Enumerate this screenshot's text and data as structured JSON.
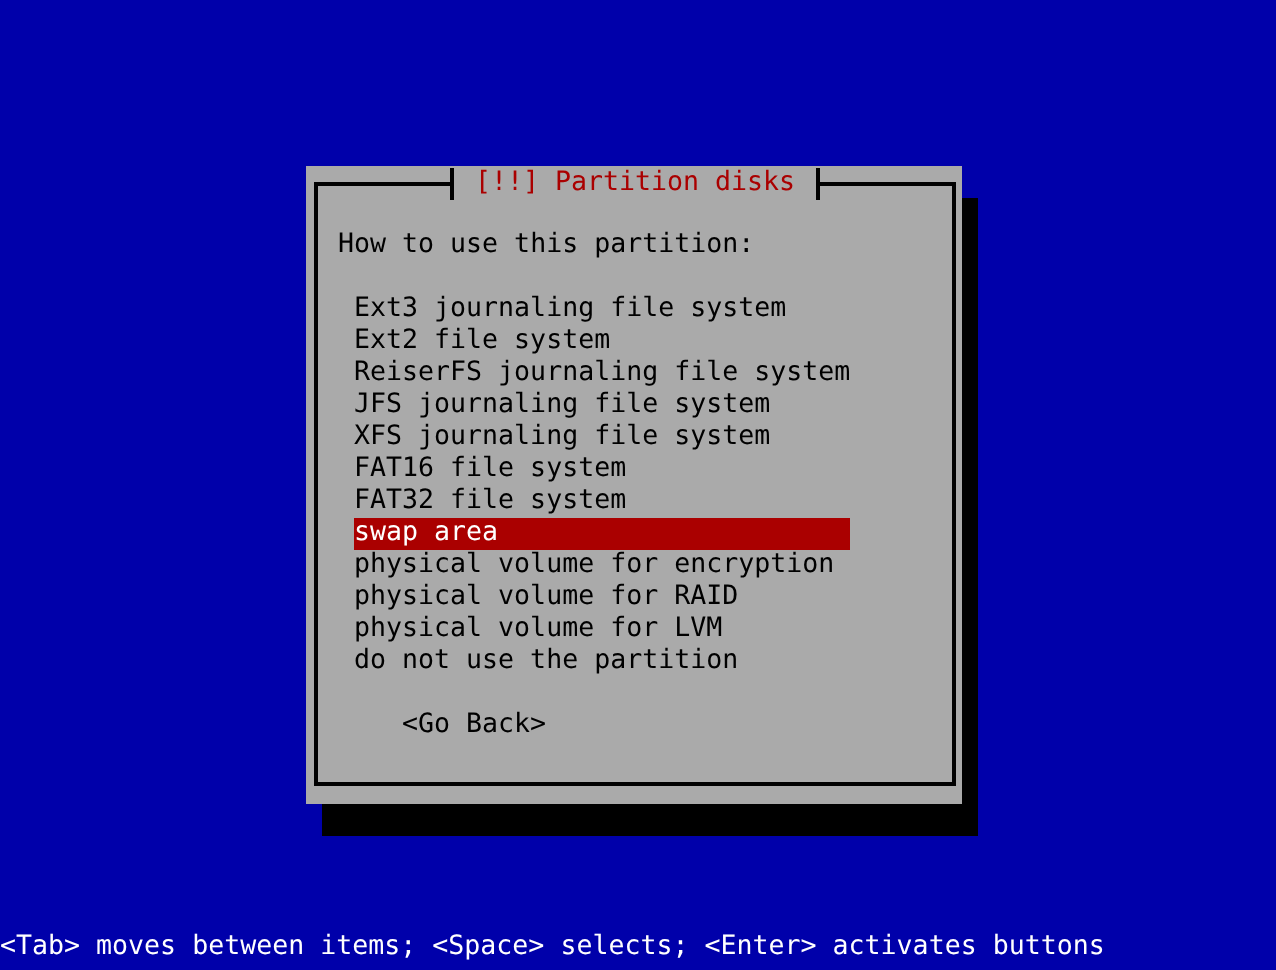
{
  "dialog": {
    "title": "[!!] Partition disks",
    "prompt": "How to use this partition:",
    "options": [
      {
        "label": "Ext3 journaling file system",
        "selected": false
      },
      {
        "label": "Ext2 file system",
        "selected": false
      },
      {
        "label": "ReiserFS journaling file system",
        "selected": false
      },
      {
        "label": "JFS journaling file system",
        "selected": false
      },
      {
        "label": "XFS journaling file system",
        "selected": false
      },
      {
        "label": "FAT16 file system",
        "selected": false
      },
      {
        "label": "FAT32 file system",
        "selected": false
      },
      {
        "label": "swap area",
        "selected": true
      },
      {
        "label": "physical volume for encryption",
        "selected": false
      },
      {
        "label": "physical volume for RAID",
        "selected": false
      },
      {
        "label": "physical volume for LVM",
        "selected": false
      },
      {
        "label": "do not use the partition",
        "selected": false
      }
    ],
    "buttons": [
      {
        "label": "<Go Back>"
      }
    ]
  },
  "status_bar": {
    "text": "<Tab> moves between items; <Space> selects; <Enter> activates buttons"
  }
}
